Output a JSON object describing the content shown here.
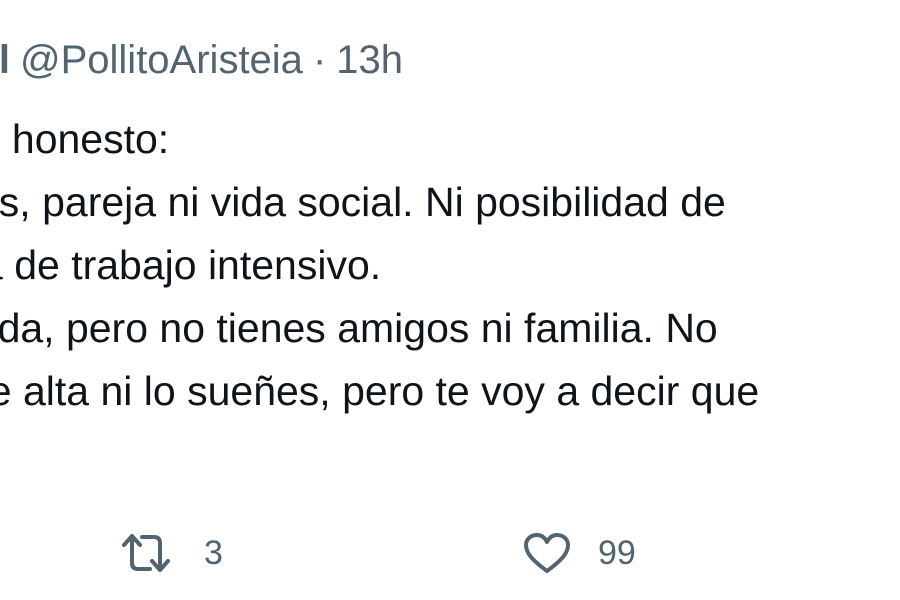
{
  "tweet": {
    "author_name_fragment": "l",
    "handle": "@PollitoAristeia",
    "separator": "·",
    "time": "13h",
    "text_lines": [
      "s honesto:",
      "os, pareja ni vida social. Ni posibilidad de",
      "a de trabajo intensivo.",
      "ierda, pero no tienes amigos ni familia. No",
      "de alta ni lo sueñes, pero te voy a decir que"
    ]
  },
  "actions": {
    "retweet": {
      "icon": "retweet-icon",
      "count": "3"
    },
    "like": {
      "icon": "heart-icon",
      "count": "99"
    }
  },
  "colors": {
    "text": "#0f1419",
    "secondary": "#536471",
    "background": "#ffffff"
  }
}
